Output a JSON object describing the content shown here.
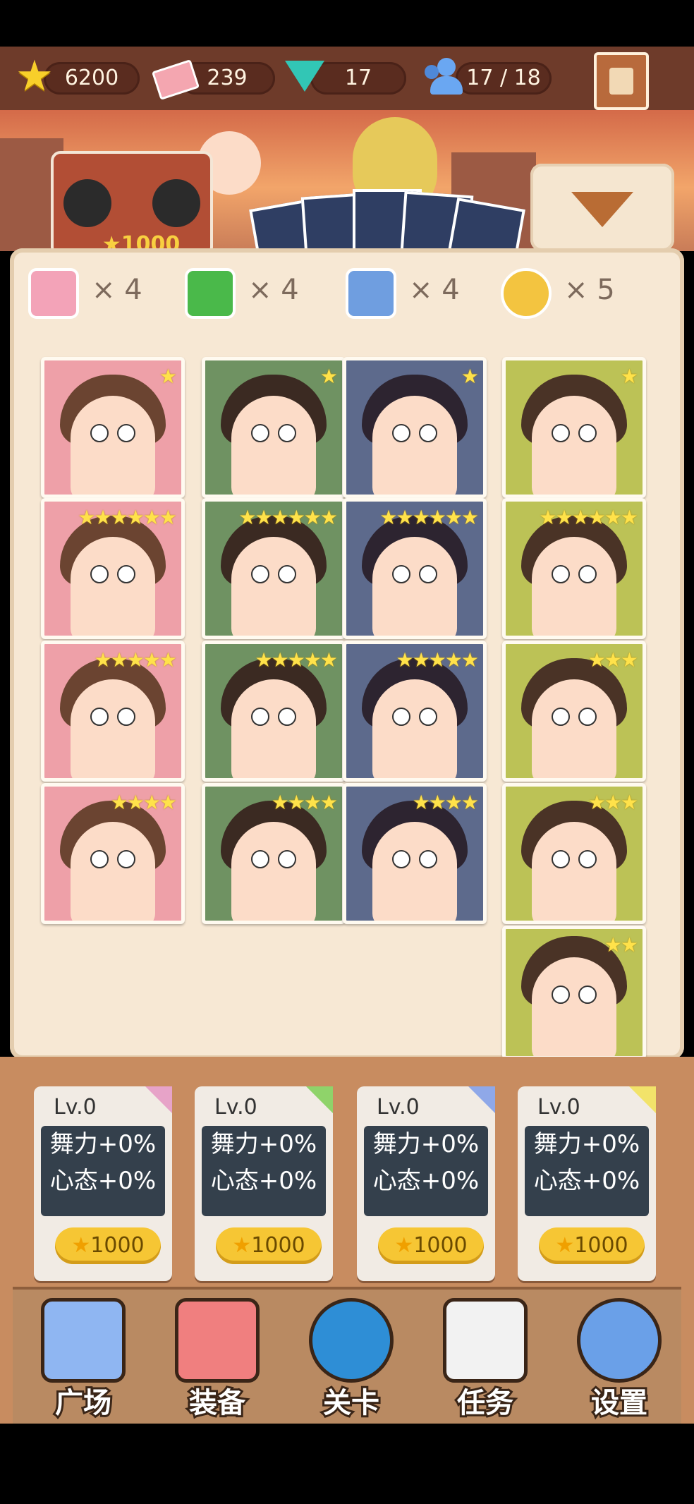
{
  "currency": {
    "stars": "6200",
    "cash": "239",
    "gems": "17",
    "dancers": "17 / 18"
  },
  "radio_cost": "1000",
  "items": [
    {
      "icon": "pink-fan-icon",
      "count": "× 4"
    },
    {
      "icon": "green-ribbon-icon",
      "count": "× 4"
    },
    {
      "icon": "hand-gesture-icon",
      "count": "× 4"
    },
    {
      "icon": "yin-yang-icon",
      "count": "× 5"
    }
  ],
  "cards": [
    {
      "color": "pink",
      "stars": "★"
    },
    {
      "color": "green",
      "stars": "★"
    },
    {
      "color": "navy",
      "stars": "★"
    },
    {
      "color": "olive",
      "stars": "★"
    },
    {
      "color": "pink",
      "stars": "★★★★★★"
    },
    {
      "color": "green",
      "stars": "★★★★★★"
    },
    {
      "color": "navy",
      "stars": "★★★★★★"
    },
    {
      "color": "olive",
      "stars": "★★★★★★"
    },
    {
      "color": "pink",
      "stars": "★★★★★"
    },
    {
      "color": "green",
      "stars": "★★★★★"
    },
    {
      "color": "navy",
      "stars": "★★★★★"
    },
    {
      "color": "olive",
      "stars": "★★★"
    },
    {
      "color": "pink",
      "stars": "★★★★"
    },
    {
      "color": "green",
      "stars": "★★★★"
    },
    {
      "color": "navy",
      "stars": "★★★★"
    },
    {
      "color": "olive",
      "stars": "★★★"
    },
    {
      "color": "olive",
      "stars": "★★"
    }
  ],
  "upgrades": [
    {
      "level": "Lv.0",
      "line1": "舞力+0%",
      "line2": "心态+0%",
      "cost": "1000",
      "corner": "#e7a3c8"
    },
    {
      "level": "Lv.0",
      "line1": "舞力+0%",
      "line2": "心态+0%",
      "cost": "1000",
      "corner": "#8fd36a"
    },
    {
      "level": "Lv.0",
      "line1": "舞力+0%",
      "line2": "心态+0%",
      "cost": "1000",
      "corner": "#8fa8e8"
    },
    {
      "level": "Lv.0",
      "line1": "舞力+0%",
      "line2": "心态+0%",
      "cost": "1000",
      "corner": "#f2e36a"
    }
  ],
  "nav": [
    {
      "label": "广场",
      "icon": "plaza-buildings-icon"
    },
    {
      "label": "装备",
      "icon": "equipment-fan-icon"
    },
    {
      "label": "关卡",
      "icon": "globe-level-icon"
    },
    {
      "label": "任务",
      "icon": "task-clipboard-icon"
    },
    {
      "label": "设置",
      "icon": "settings-gear-icon"
    }
  ]
}
